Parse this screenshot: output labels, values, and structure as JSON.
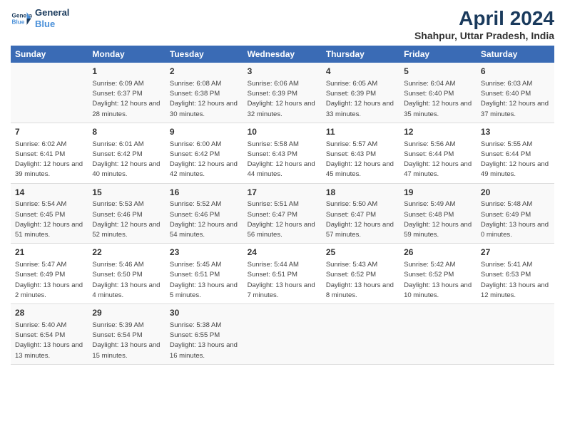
{
  "logo": {
    "line1": "General",
    "line2": "Blue"
  },
  "title": "April 2024",
  "subtitle": "Shahpur, Uttar Pradesh, India",
  "days_of_week": [
    "Sunday",
    "Monday",
    "Tuesday",
    "Wednesday",
    "Thursday",
    "Friday",
    "Saturday"
  ],
  "weeks": [
    [
      {
        "day": "",
        "sunrise": "",
        "sunset": "",
        "daylight": ""
      },
      {
        "day": "1",
        "sunrise": "Sunrise: 6:09 AM",
        "sunset": "Sunset: 6:37 PM",
        "daylight": "Daylight: 12 hours and 28 minutes."
      },
      {
        "day": "2",
        "sunrise": "Sunrise: 6:08 AM",
        "sunset": "Sunset: 6:38 PM",
        "daylight": "Daylight: 12 hours and 30 minutes."
      },
      {
        "day": "3",
        "sunrise": "Sunrise: 6:06 AM",
        "sunset": "Sunset: 6:39 PM",
        "daylight": "Daylight: 12 hours and 32 minutes."
      },
      {
        "day": "4",
        "sunrise": "Sunrise: 6:05 AM",
        "sunset": "Sunset: 6:39 PM",
        "daylight": "Daylight: 12 hours and 33 minutes."
      },
      {
        "day": "5",
        "sunrise": "Sunrise: 6:04 AM",
        "sunset": "Sunset: 6:40 PM",
        "daylight": "Daylight: 12 hours and 35 minutes."
      },
      {
        "day": "6",
        "sunrise": "Sunrise: 6:03 AM",
        "sunset": "Sunset: 6:40 PM",
        "daylight": "Daylight: 12 hours and 37 minutes."
      }
    ],
    [
      {
        "day": "7",
        "sunrise": "Sunrise: 6:02 AM",
        "sunset": "Sunset: 6:41 PM",
        "daylight": "Daylight: 12 hours and 39 minutes."
      },
      {
        "day": "8",
        "sunrise": "Sunrise: 6:01 AM",
        "sunset": "Sunset: 6:42 PM",
        "daylight": "Daylight: 12 hours and 40 minutes."
      },
      {
        "day": "9",
        "sunrise": "Sunrise: 6:00 AM",
        "sunset": "Sunset: 6:42 PM",
        "daylight": "Daylight: 12 hours and 42 minutes."
      },
      {
        "day": "10",
        "sunrise": "Sunrise: 5:58 AM",
        "sunset": "Sunset: 6:43 PM",
        "daylight": "Daylight: 12 hours and 44 minutes."
      },
      {
        "day": "11",
        "sunrise": "Sunrise: 5:57 AM",
        "sunset": "Sunset: 6:43 PM",
        "daylight": "Daylight: 12 hours and 45 minutes."
      },
      {
        "day": "12",
        "sunrise": "Sunrise: 5:56 AM",
        "sunset": "Sunset: 6:44 PM",
        "daylight": "Daylight: 12 hours and 47 minutes."
      },
      {
        "day": "13",
        "sunrise": "Sunrise: 5:55 AM",
        "sunset": "Sunset: 6:44 PM",
        "daylight": "Daylight: 12 hours and 49 minutes."
      }
    ],
    [
      {
        "day": "14",
        "sunrise": "Sunrise: 5:54 AM",
        "sunset": "Sunset: 6:45 PM",
        "daylight": "Daylight: 12 hours and 51 minutes."
      },
      {
        "day": "15",
        "sunrise": "Sunrise: 5:53 AM",
        "sunset": "Sunset: 6:46 PM",
        "daylight": "Daylight: 12 hours and 52 minutes."
      },
      {
        "day": "16",
        "sunrise": "Sunrise: 5:52 AM",
        "sunset": "Sunset: 6:46 PM",
        "daylight": "Daylight: 12 hours and 54 minutes."
      },
      {
        "day": "17",
        "sunrise": "Sunrise: 5:51 AM",
        "sunset": "Sunset: 6:47 PM",
        "daylight": "Daylight: 12 hours and 56 minutes."
      },
      {
        "day": "18",
        "sunrise": "Sunrise: 5:50 AM",
        "sunset": "Sunset: 6:47 PM",
        "daylight": "Daylight: 12 hours and 57 minutes."
      },
      {
        "day": "19",
        "sunrise": "Sunrise: 5:49 AM",
        "sunset": "Sunset: 6:48 PM",
        "daylight": "Daylight: 12 hours and 59 minutes."
      },
      {
        "day": "20",
        "sunrise": "Sunrise: 5:48 AM",
        "sunset": "Sunset: 6:49 PM",
        "daylight": "Daylight: 13 hours and 0 minutes."
      }
    ],
    [
      {
        "day": "21",
        "sunrise": "Sunrise: 5:47 AM",
        "sunset": "Sunset: 6:49 PM",
        "daylight": "Daylight: 13 hours and 2 minutes."
      },
      {
        "day": "22",
        "sunrise": "Sunrise: 5:46 AM",
        "sunset": "Sunset: 6:50 PM",
        "daylight": "Daylight: 13 hours and 4 minutes."
      },
      {
        "day": "23",
        "sunrise": "Sunrise: 5:45 AM",
        "sunset": "Sunset: 6:51 PM",
        "daylight": "Daylight: 13 hours and 5 minutes."
      },
      {
        "day": "24",
        "sunrise": "Sunrise: 5:44 AM",
        "sunset": "Sunset: 6:51 PM",
        "daylight": "Daylight: 13 hours and 7 minutes."
      },
      {
        "day": "25",
        "sunrise": "Sunrise: 5:43 AM",
        "sunset": "Sunset: 6:52 PM",
        "daylight": "Daylight: 13 hours and 8 minutes."
      },
      {
        "day": "26",
        "sunrise": "Sunrise: 5:42 AM",
        "sunset": "Sunset: 6:52 PM",
        "daylight": "Daylight: 13 hours and 10 minutes."
      },
      {
        "day": "27",
        "sunrise": "Sunrise: 5:41 AM",
        "sunset": "Sunset: 6:53 PM",
        "daylight": "Daylight: 13 hours and 12 minutes."
      }
    ],
    [
      {
        "day": "28",
        "sunrise": "Sunrise: 5:40 AM",
        "sunset": "Sunset: 6:54 PM",
        "daylight": "Daylight: 13 hours and 13 minutes."
      },
      {
        "day": "29",
        "sunrise": "Sunrise: 5:39 AM",
        "sunset": "Sunset: 6:54 PM",
        "daylight": "Daylight: 13 hours and 15 minutes."
      },
      {
        "day": "30",
        "sunrise": "Sunrise: 5:38 AM",
        "sunset": "Sunset: 6:55 PM",
        "daylight": "Daylight: 13 hours and 16 minutes."
      },
      {
        "day": "",
        "sunrise": "",
        "sunset": "",
        "daylight": ""
      },
      {
        "day": "",
        "sunrise": "",
        "sunset": "",
        "daylight": ""
      },
      {
        "day": "",
        "sunrise": "",
        "sunset": "",
        "daylight": ""
      },
      {
        "day": "",
        "sunrise": "",
        "sunset": "",
        "daylight": ""
      }
    ]
  ]
}
